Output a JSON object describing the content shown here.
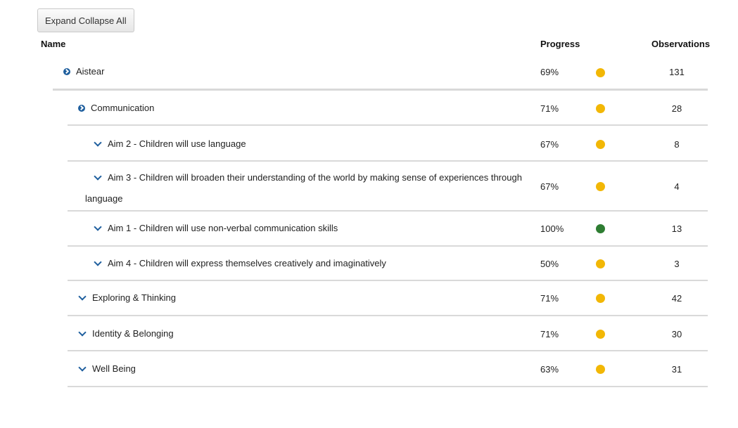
{
  "toolbar": {
    "expand_collapse_label": "Expand Collapse All"
  },
  "columns": {
    "name": "Name",
    "progress": "Progress",
    "observations": "Observations"
  },
  "colors": {
    "yellow": "#f2b705",
    "green": "#2e7d32",
    "accent": "#1f5f9e"
  },
  "rows": [
    {
      "name": "Aistear",
      "progress": "69%",
      "status": "yellow",
      "observations": "131",
      "icon": "circle-chevron-right-icon"
    },
    {
      "name": "Communication",
      "progress": "71%",
      "status": "yellow",
      "observations": "28",
      "icon": "circle-chevron-right-icon"
    },
    {
      "name": "Aim 2 - Children will use language",
      "progress": "67%",
      "status": "yellow",
      "observations": "8",
      "icon": "chevron-down-icon"
    },
    {
      "name": "Aim 3 - Children will broaden their understanding of the world by making sense of experiences through language",
      "progress": "67%",
      "status": "yellow",
      "observations": "4",
      "icon": "chevron-down-icon"
    },
    {
      "name": "Aim 1 - Children will use non-verbal communication skills",
      "progress": "100%",
      "status": "green",
      "observations": "13",
      "icon": "chevron-down-icon"
    },
    {
      "name": "Aim 4 - Children will express themselves creatively and imaginatively",
      "progress": "50%",
      "status": "yellow",
      "observations": "3",
      "icon": "chevron-down-icon"
    },
    {
      "name": "Exploring & Thinking",
      "progress": "71%",
      "status": "yellow",
      "observations": "42",
      "icon": "chevron-down-icon"
    },
    {
      "name": "Identity & Belonging",
      "progress": "71%",
      "status": "yellow",
      "observations": "30",
      "icon": "chevron-down-icon"
    },
    {
      "name": "Well Being",
      "progress": "63%",
      "status": "yellow",
      "observations": "31",
      "icon": "chevron-down-icon"
    }
  ]
}
